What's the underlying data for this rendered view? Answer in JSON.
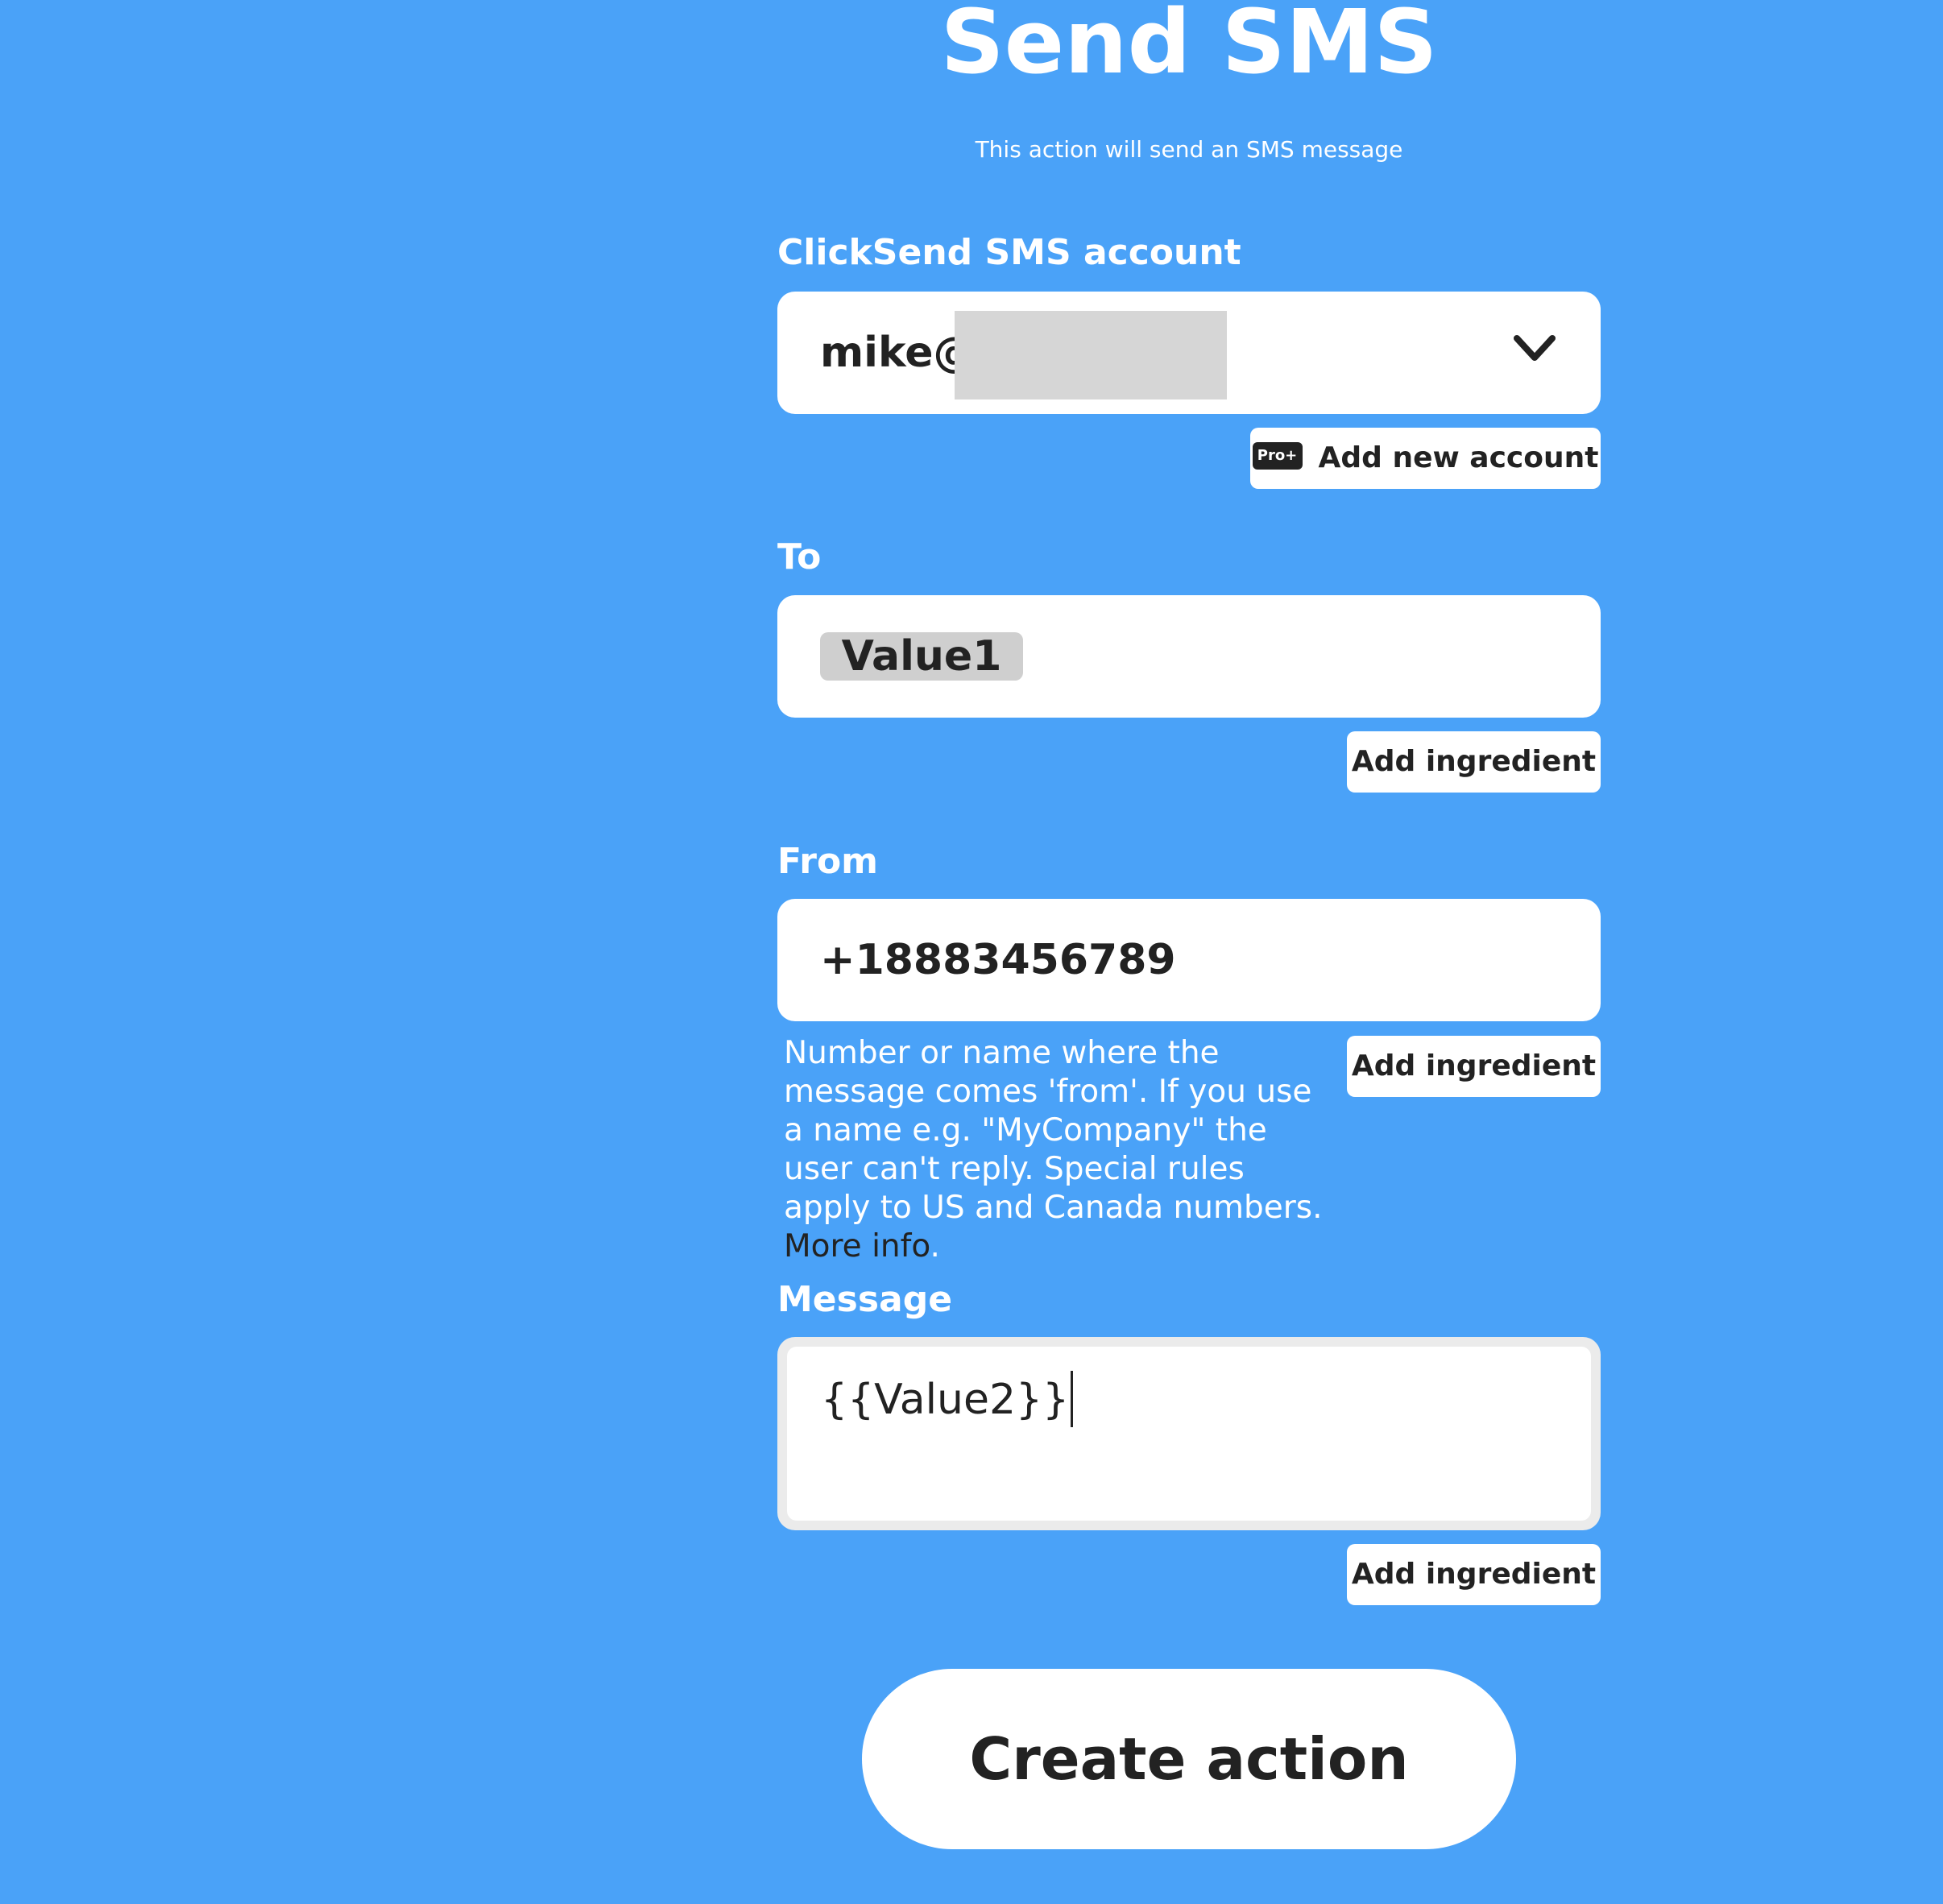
{
  "header": {
    "title": "Send SMS",
    "subtitle": "This action will send an SMS message"
  },
  "account": {
    "label": "ClickSend SMS account",
    "selected_value": "mike@",
    "add_new_badge": "Pro+",
    "add_new_label": "Add new account"
  },
  "to": {
    "label": "To",
    "chip_value": "Value1",
    "add_ingredient_label": "Add ingredient"
  },
  "from": {
    "label": "From",
    "value": "+18883456789",
    "helper_text": "Number or name where the message comes 'from'. If you use a name e.g. \"MyCompany\" the user can't reply. Special rules apply to US and Canada numbers. ",
    "helper_link": "More info",
    "helper_period": ".",
    "add_ingredient_label": "Add ingredient"
  },
  "message": {
    "label": "Message",
    "value": "{{Value2}}",
    "add_ingredient_label": "Add ingredient"
  },
  "footer": {
    "create_label": "Create action"
  },
  "colors": {
    "background": "#4aa2f8",
    "text_dark": "#222222",
    "white": "#ffffff"
  }
}
